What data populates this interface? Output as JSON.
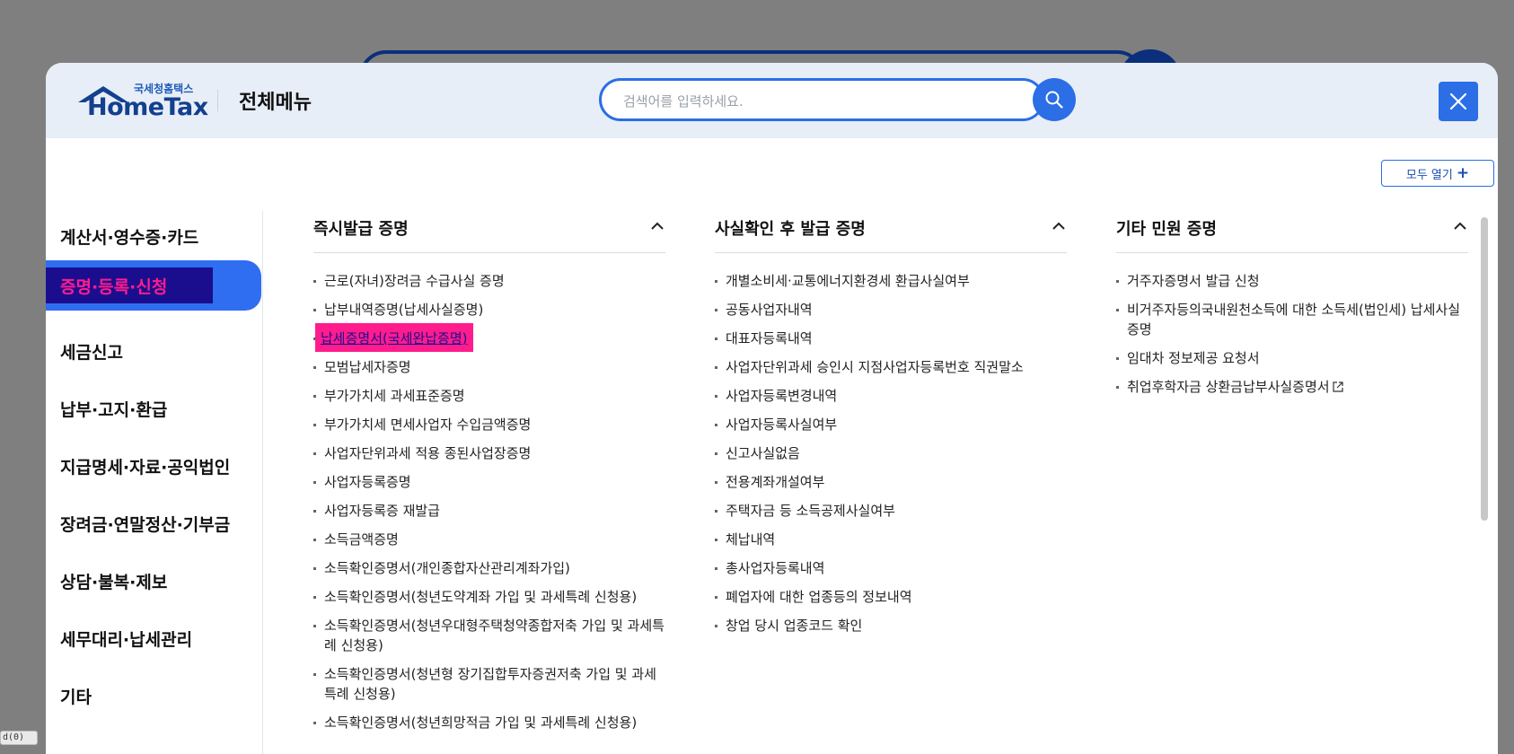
{
  "header": {
    "logo_small": "국세청홈택스",
    "logo_main": "HomeTax",
    "title": "전체메뉴",
    "search_placeholder": "검색어를 입력하세요.",
    "search_icon": "search-icon",
    "close_icon": "close-icon"
  },
  "toolbar": {
    "open_all_label": "모두 열기"
  },
  "nav": {
    "items": [
      "계산서·영수증·카드",
      "증명·등록·신청",
      "세금신고",
      "납부·고지·환급",
      "지급명세·자료·공익법인",
      "장려금·연말정산·기부금",
      "상담·불복·제보",
      "세무대리·납세관리",
      "기타"
    ],
    "active_index": 1
  },
  "columns": [
    {
      "title": "즉시발급 증명",
      "items": [
        "근로(자녀)장려금 수급사실 증명",
        "납부내역증명(납세사실증명)",
        "납세증명서(국세완납증명)",
        "모범납세자증명",
        "부가가치세 과세표준증명",
        "부가가치세 면세사업자 수입금액증명",
        "사업자단위과세 적용 종된사업장증명",
        "사업자등록증명",
        "사업자등록증 재발급",
        "소득금액증명",
        "소득확인증명서(개인종합자산관리계좌가입)",
        "소득확인증명서(청년도약계좌 가입 및 과세특례 신청용)",
        "소득확인증명서(청년우대형주택청약종합저축 가입 및 과세특례 신청용)",
        "소득확인증명서(청년형 장기집합투자증권저축 가입 및 과세특례 신청용)",
        "소득확인증명서(청년희망적금 가입 및 과세특례 신청용)"
      ],
      "highlighted_index": 2
    },
    {
      "title": "사실확인 후 발급 증명",
      "items": [
        "개별소비세·교통에너지환경세 환급사실여부",
        "공동사업자내역",
        "대표자등록내역",
        "사업자단위과세 승인시 지점사업자등록번호 직권말소",
        "사업자등록변경내역",
        "사업자등록사실여부",
        "신고사실없음",
        "전용계좌개설여부",
        "주택자금 등 소득공제사실여부",
        "체납내역",
        "총사업자등록내역",
        "폐업자에 대한 업종등의 정보내역",
        "창업 당시 업종코드 확인"
      ]
    },
    {
      "title": "기타 민원 증명",
      "items": [
        "거주자증명서 발급 신청",
        "비거주자등의국내원천소득에 대한 소득세(법인세) 납세사실증명",
        "임대차 정보제공 요청서",
        "취업후학자금 상환금납부사실증명서"
      ],
      "external_link_index": 3
    }
  ],
  "status_bar": {
    "text": "d(0)"
  },
  "colors": {
    "accent": "#2b6ee6",
    "highlight_bg": "#ff1c8d",
    "highlight_text": "#1a0e8f"
  }
}
